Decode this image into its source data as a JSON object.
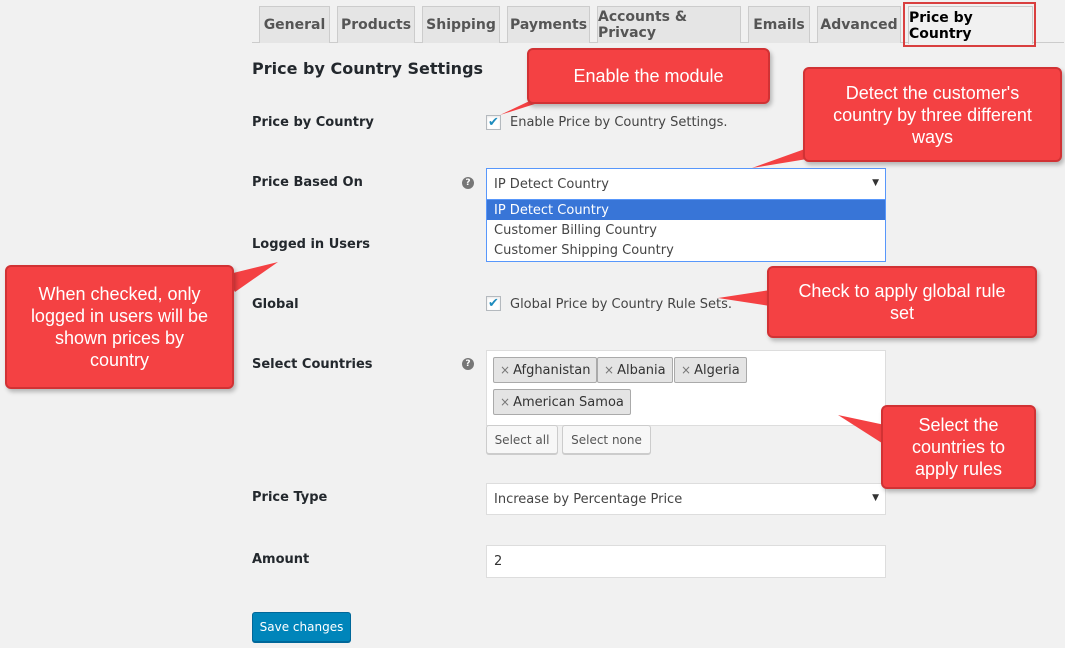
{
  "tabs": [
    {
      "label": "General"
    },
    {
      "label": "Products"
    },
    {
      "label": "Shipping"
    },
    {
      "label": "Payments"
    },
    {
      "label": "Accounts & Privacy"
    },
    {
      "label": "Emails"
    },
    {
      "label": "Advanced"
    },
    {
      "label": "Price by Country",
      "active": true
    }
  ],
  "section_title": "Price by Country Settings",
  "fields": {
    "price_by_country": {
      "label": "Price by Country",
      "checkbox_label": "Enable Price by Country Settings.",
      "checked": true
    },
    "price_based_on": {
      "label": "Price Based On",
      "help": "?",
      "value": "IP Detect Country",
      "options": [
        "IP Detect Country",
        "Customer Billing Country",
        "Customer Shipping Country"
      ]
    },
    "logged_in_users": {
      "label": "Logged in Users"
    },
    "global": {
      "label": "Global",
      "checkbox_label": "Global Price by Country Rule Sets.",
      "checked": true
    },
    "select_countries": {
      "label": "Select Countries",
      "help": "?",
      "chips": [
        "Afghanistan",
        "Albania",
        "Algeria",
        "American Samoa"
      ],
      "remove_glyph": "×",
      "select_all": "Select all",
      "select_none": "Select none"
    },
    "price_type": {
      "label": "Price Type",
      "value": "Increase by Percentage Price"
    },
    "amount": {
      "label": "Amount",
      "value": "2"
    }
  },
  "save_label": "Save changes",
  "callouts": {
    "enable": "Enable the module",
    "detect": "Detect the customer's country by three different ways",
    "logged": "When checked, only logged in users will be shown prices by country",
    "global": "Check to apply global rule set",
    "select": "Select the countries to apply rules"
  },
  "colors": {
    "callout": "#f44143",
    "primary_button": "#0085ba",
    "dropdown_highlight": "#3875d7",
    "tab_highlight": "#d93f3f"
  }
}
